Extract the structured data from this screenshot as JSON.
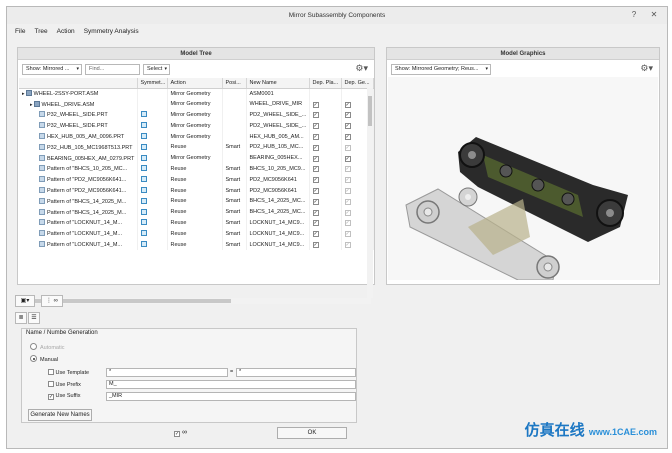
{
  "window": {
    "title": "Mirror Subassembly Components"
  },
  "menu": [
    "File",
    "Tree",
    "Action",
    "Symmetry Analysis"
  ],
  "model_tree": {
    "header": "Model Tree",
    "show_filter": "Show: Mirrored ...",
    "find_placeholder": "Find...",
    "select_label": "Select",
    "columns": [
      "Symmet...",
      "Action",
      "Posi...",
      "New Name",
      "Dep. Pla...",
      "Dep. Ge..."
    ],
    "rows": [
      {
        "name": "WHEEL-2SSY-PORT.ASM",
        "indent": 0,
        "icon": "assembly-icon",
        "sym": false,
        "action": "Mirror Geometry",
        "pos": "",
        "new_name": "ASM0001",
        "dp": "",
        "dg": ""
      },
      {
        "name": "WHEEL_DRIVE.ASM",
        "indent": 1,
        "icon": "assembly-icon",
        "sym": false,
        "action": "Mirror Geometry",
        "pos": "",
        "new_name": "WHEEL_DRIVE_MIR",
        "dp": "on",
        "dg": "on"
      },
      {
        "name": "P32_WHEEL_SIDE.PRT",
        "indent": 2,
        "icon": "part-icon",
        "sym": true,
        "action": "Mirror Geometry",
        "pos": "",
        "new_name": "PD2_WHEEL_SIDE_...",
        "dp": "on",
        "dg": "on"
      },
      {
        "name": "P32_WHEEL_SIDE.PRT",
        "indent": 2,
        "icon": "part-icon",
        "sym": true,
        "action": "Mirror Geometry",
        "pos": "",
        "new_name": "PD2_WHEEL_SIDE_...",
        "dp": "on",
        "dg": "on"
      },
      {
        "name": "HEX_HUB_005_AM_0096.PRT",
        "indent": 2,
        "icon": "part-icon",
        "sym": true,
        "action": "Mirror Geometry",
        "pos": "",
        "new_name": "HEX_HUB_005_AM...",
        "dp": "on",
        "dg": "on"
      },
      {
        "name": "P32_HUB_105_MC1968T513.PRT",
        "indent": 2,
        "icon": "part-icon",
        "sym": true,
        "action": "Reuse",
        "pos": "Smart",
        "new_name": "PD2_HUB_105_MC...",
        "dp": "on",
        "dg": "grey"
      },
      {
        "name": "BEARING_005HEX_AM_0279.PRT",
        "indent": 2,
        "icon": "part-icon",
        "sym": true,
        "action": "Mirror Geometry",
        "pos": "",
        "new_name": "BEARING_005HEX...",
        "dp": "on",
        "dg": "on"
      },
      {
        "name": "Pattern of \"BHCS_10_205_MC...",
        "indent": 2,
        "icon": "part-icon",
        "sym": true,
        "action": "Reuse",
        "pos": "Smart",
        "new_name": "BHCS_10_205_MC9...",
        "dp": "on",
        "dg": "grey"
      },
      {
        "name": "Pattern of \"PD2_MC9056K641...",
        "indent": 2,
        "icon": "part-icon",
        "sym": true,
        "action": "Reuse",
        "pos": "Smart",
        "new_name": "PD2_MC9056K641",
        "dp": "on",
        "dg": "grey"
      },
      {
        "name": "Pattern of \"PD2_MC9056K641...",
        "indent": 2,
        "icon": "part-icon",
        "sym": true,
        "action": "Reuse",
        "pos": "Smart",
        "new_name": "PD2_MC9056K641",
        "dp": "on",
        "dg": "grey"
      },
      {
        "name": "Pattern of \"BHCS_14_2025_M...",
        "indent": 2,
        "icon": "part-icon",
        "sym": true,
        "action": "Reuse",
        "pos": "Smart",
        "new_name": "BHCS_14_2025_MC...",
        "dp": "on",
        "dg": "grey"
      },
      {
        "name": "Pattern of \"BHCS_14_2025_M...",
        "indent": 2,
        "icon": "part-icon",
        "sym": true,
        "action": "Reuse",
        "pos": "Smart",
        "new_name": "BHCS_14_2025_MC...",
        "dp": "on",
        "dg": "grey"
      },
      {
        "name": "Pattern of \"LOCKNUT_14_M...",
        "indent": 2,
        "icon": "part-icon",
        "sym": true,
        "action": "Reuse",
        "pos": "Smart",
        "new_name": "LOCKNUT_14_MC9...",
        "dp": "on",
        "dg": "grey"
      },
      {
        "name": "Pattern of \"LOCKNUT_14_M...",
        "indent": 2,
        "icon": "part-icon",
        "sym": true,
        "action": "Reuse",
        "pos": "Smart",
        "new_name": "LOCKNUT_14_MC9...",
        "dp": "on",
        "dg": "grey"
      },
      {
        "name": "Pattern of \"LOCKNUT_14_M...",
        "indent": 2,
        "icon": "part-icon",
        "sym": true,
        "action": "Reuse",
        "pos": "Smart",
        "new_name": "LOCKNUT_14_MC9...",
        "dp": "on",
        "dg": "grey"
      }
    ]
  },
  "model_graphics": {
    "header": "Model Graphics",
    "show_filter": "Show: Mirrored Geometry; Reus..."
  },
  "name_generation": {
    "title": "Name / Numbe Generation",
    "automatic_label": "Automatic",
    "manual_label": "Manual",
    "use_template_label": "Use Template",
    "template_value": "*",
    "template_eq": "=",
    "template_result": "*",
    "use_prefix_label": "Use Prefix",
    "prefix_value": "M_",
    "use_suffix_label": "Use Suffix",
    "suffix_value": "_MIR",
    "generate_button": "Generate New Names"
  },
  "footer": {
    "ok_label": "OK"
  },
  "watermark": {
    "main": "仿真在线",
    "sub": "www.1CAE.com"
  },
  "colors": {
    "accent": "#1c77c3",
    "panel_header": "#e4e4e4",
    "background": "#f0f0f0"
  }
}
